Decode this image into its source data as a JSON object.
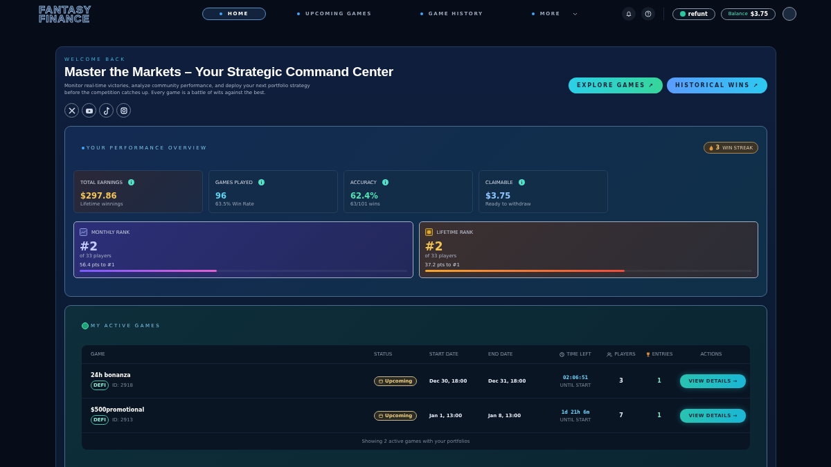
{
  "header": {
    "logo": [
      "FANTASY",
      "FINANCE"
    ],
    "nav": [
      {
        "label": "HOME",
        "selected": true,
        "has_menu": false
      },
      {
        "label": "UPCOMING GAMES",
        "selected": false,
        "has_menu": false
      },
      {
        "label": "GAME HISTORY",
        "selected": false,
        "has_menu": false
      },
      {
        "label": "MORE",
        "selected": false,
        "has_menu": true
      }
    ],
    "user": "refunt",
    "balance_label": "Balance",
    "balance": "$3.75"
  },
  "hero": {
    "eyebrow": "WELCOME BACK",
    "title": "Master the Markets – Your Strategic Command Center",
    "description": "Monitor real-time victories, analyze community performance, and deploy your next portfolio strategy before the competition catches up. Every game is a battle of wits against the best.",
    "buttons": [
      {
        "label": "EXPLORE GAMES ↗",
        "kind": "green"
      },
      {
        "label": "HISTORICAL WINS ↗",
        "kind": "blue"
      }
    ]
  },
  "performance": {
    "title": "YOUR PERFORMANCE OVERVIEW",
    "streak": {
      "count": "3",
      "label": "WIN STREAK"
    },
    "stats": [
      {
        "label": "TOTAL EARNINGS",
        "value": "$297.86",
        "sub": "Lifetime winnings",
        "color": "#f5c451"
      },
      {
        "label": "GAMES PLAYED",
        "value": "96",
        "sub": "63.5% Win Rate",
        "color": "#5fd4f0"
      },
      {
        "label": "ACCURACY",
        "value": "62.4%",
        "sub": "63/101 wins",
        "color": "#4fe3b0"
      },
      {
        "label": "CLAIMABLE",
        "value": "$3.75",
        "sub": "Ready to withdraw",
        "color": "#8fc4ff"
      }
    ],
    "ranks": [
      {
        "kind": "monthly",
        "label": "MONTHLY RANK",
        "rank": "#2",
        "of": "of 33 players",
        "gap": "56.4 pts to #1",
        "level": 0.42
      },
      {
        "kind": "lifetime",
        "label": "LIFETIME RANK",
        "rank": "#2",
        "of": "of 33 players",
        "gap": "37.2 pts to #1",
        "level": 0.61
      }
    ]
  },
  "active_games": {
    "title": "MY ACTIVE GAMES",
    "columns": [
      "GAME",
      "STATUS",
      "START DATE",
      "END DATE",
      "TIME LEFT",
      "PLAYERS",
      "ENTRIES",
      "ACTIONS"
    ],
    "rows": [
      {
        "name": "24h bonanza",
        "tag": "DEFI",
        "id": "ID: 2918",
        "status": "Upcoming",
        "start": "Dec 30, 18:00",
        "end": "Dec 31, 18:00",
        "time_left": "02:06:51",
        "time_note": "UNTIL START",
        "players": "3",
        "entries": "1",
        "action": "VIEW DETAILS →"
      },
      {
        "name": "$500promotional",
        "tag": "DEFI",
        "id": "ID: 2913",
        "status": "Upcoming",
        "start": "Jan 1, 13:00",
        "end": "Jan 8, 13:00",
        "time_left": "1d 21h 6m",
        "time_note": "UNTIL START",
        "players": "7",
        "entries": "1",
        "action": "VIEW DETAILS →"
      }
    ],
    "footer": "Showing 2 active games with your portfolios"
  }
}
